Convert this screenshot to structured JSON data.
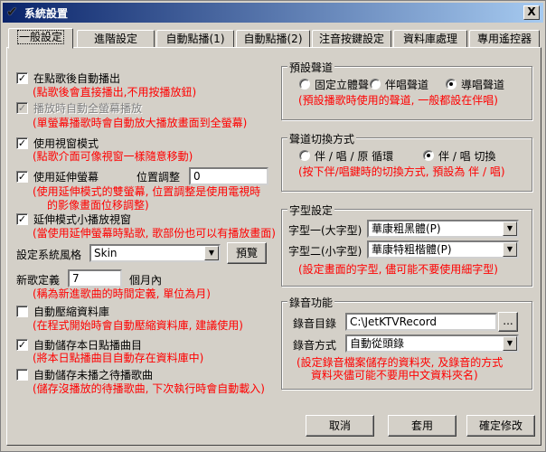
{
  "window": {
    "title": "系統設置",
    "close_label": "X"
  },
  "tabs": [
    "一般設定",
    "進階設定",
    "自動點播(1)",
    "自動點播(2)",
    "注音按鍵設定",
    "資料庫處理",
    "專用遙控器"
  ],
  "left": {
    "auto_play": {
      "label": "在點歌後自動播出",
      "checked": true,
      "note": "(點歌後會直接播出,不用按播放鈕)"
    },
    "fullscreen": {
      "label": "播放時自動全螢幕播放",
      "checked": true,
      "disabled": true,
      "note": "(單螢幕播歌時會自動放大播放畫面到全螢幕)"
    },
    "window_mode": {
      "label": "使用視窗模式",
      "checked": true,
      "note": "(點歌介面可像視窗一樣隨意移動)"
    },
    "extend": {
      "label": "使用延伸螢幕",
      "checked": true,
      "pos_label": "位置調整",
      "pos_value": "0",
      "note1": "(使用延伸模式的雙螢幕, 位置調整是使用電視時",
      "note2": "的影像畫面位移調整)"
    },
    "small_window": {
      "label": "延伸模式小播放視窗",
      "checked": true,
      "note": "(當使用延伸螢幕時點歌, 歌部份也可以有播放畫面)"
    },
    "skin": {
      "label": "設定系統風格",
      "value": "Skin",
      "preview": "預覽"
    },
    "new_song": {
      "label": "新歌定義",
      "value": "7",
      "unit": "個月內",
      "note": "(稱為新進歌曲的時間定義, 單位為月)"
    },
    "compress": {
      "label": "自動壓縮資料庫",
      "checked": false,
      "note": "(在程式開始時會自動壓縮資料庫, 建議使用)"
    },
    "save_today": {
      "label": "自動儲存本日點播曲目",
      "checked": true,
      "note": "(將本日點播曲目自動存在資料庫中)"
    },
    "save_pending": {
      "label": "自動儲存未播之待播歌曲",
      "checked": false,
      "note": "(儲存沒播放的待播歌曲, 下次執行時會自動載入)"
    }
  },
  "channel": {
    "title": "預設聲道",
    "options": [
      "固定立體聲",
      "伴唱聲道",
      "導唱聲道"
    ],
    "selected": 2,
    "note": "(預設播歌時使用的聲道, 一般都設在伴唱)"
  },
  "switch": {
    "title": "聲道切換方式",
    "options": [
      "伴 / 唱 / 原 循環",
      "伴 / 唱  切換"
    ],
    "selected": 1,
    "note": "(按下伴/唱鍵時的切換方式, 預設為 伴 / 唱)"
  },
  "font": {
    "title": "字型設定",
    "large_label": "字型一(大字型)",
    "large_value": "華康粗黑體(P)",
    "small_label": "字型二(小字型)",
    "small_value": "華康特粗楷體(P)",
    "note": "(設定畫面的字型, 儘可能不要使用細字型)"
  },
  "record": {
    "title": "錄音功能",
    "dir_label": "錄音目錄",
    "dir_value": "C:\\JetKTVRecord",
    "browse": "...",
    "mode_label": "錄音方式",
    "mode_value": "自動從頭錄",
    "note1": "(設定錄音檔案儲存的資料夾, 及錄音的方式",
    "note2": "資料夾儘可能不要用中文資料夾名)"
  },
  "buttons": {
    "cancel": "取消",
    "apply": "套用",
    "ok": "確定修改"
  }
}
